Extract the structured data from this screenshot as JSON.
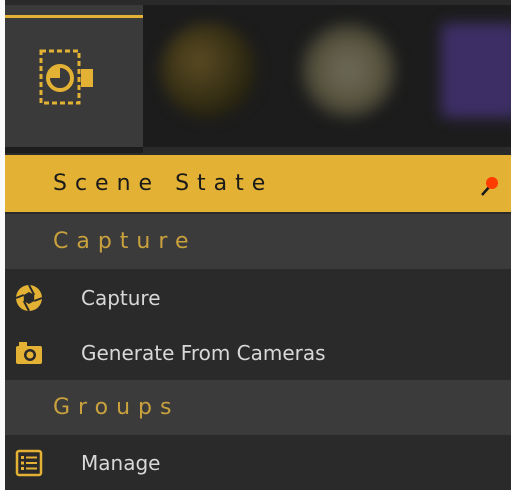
{
  "panel": {
    "scene_state_label": "Scene State"
  },
  "sections": [
    {
      "title": "Capture",
      "items": [
        {
          "label": "Capture",
          "icon": "aperture-icon"
        },
        {
          "label": "Generate From Cameras",
          "icon": "camera-icon"
        }
      ]
    },
    {
      "title": "Groups",
      "items": [
        {
          "label": "Manage",
          "icon": "list-icon"
        }
      ]
    }
  ],
  "colors": {
    "accent": "#e3b235",
    "section_text": "#c9a13d",
    "pin": "#ff3b00"
  }
}
